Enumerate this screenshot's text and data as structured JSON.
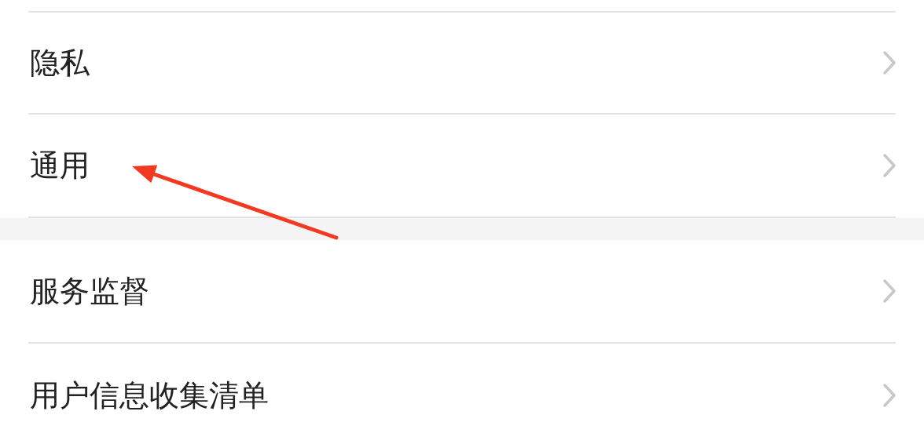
{
  "groups": [
    {
      "items": [
        {
          "label": "隐私",
          "annotated": false
        },
        {
          "label": "通用",
          "annotated": true
        }
      ]
    },
    {
      "items": [
        {
          "label": "服务监督",
          "annotated": false
        },
        {
          "label": "用户信息收集清单",
          "annotated": false
        }
      ]
    }
  ]
}
